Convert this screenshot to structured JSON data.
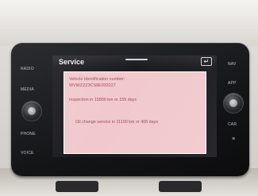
{
  "screen": {
    "title": "Service",
    "back_icon": "back-arrow-icon",
    "vin_label": "Vehicle Identification number:",
    "vin_value": "WVWZZZ3CS8E033227",
    "inspection": "Inspection in 15800 km or 155 days",
    "oil_change": "Oil change service in 11100 km or 406 days"
  },
  "left_buttons": {
    "radio": "RADIO",
    "media": "MEDIA",
    "phone": "PHONE",
    "voice": "VOICE"
  },
  "right_buttons": {
    "nav": "NAV",
    "app": "APP",
    "car": "CAR"
  },
  "colors": {
    "panel_bg": "#f1c9cc",
    "panel_text": "#a14a55",
    "bezel": "#141517"
  }
}
